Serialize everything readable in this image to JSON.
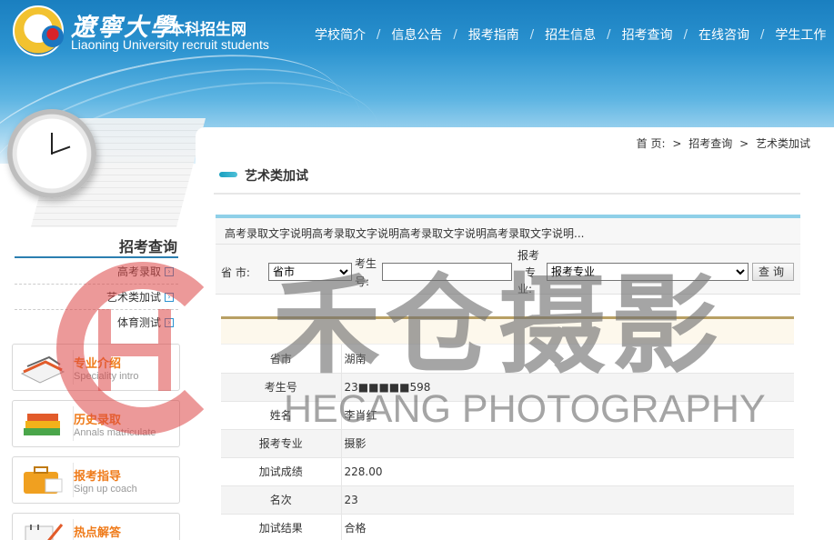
{
  "header": {
    "logo_cn": "遼寧大學",
    "logo_cn2": "本科招生网",
    "logo_en": "Liaoning University recruit students",
    "nav": [
      "学校简介",
      "信息公告",
      "报考指南",
      "招生信息",
      "招考查询",
      "在线咨询",
      "学生工作"
    ],
    "nav_sep": "/"
  },
  "sidebar": {
    "title": "招考查询",
    "links": [
      "高考录取",
      "艺术类加试",
      "体育测试"
    ],
    "cards": [
      {
        "cn": "专业介绍",
        "en": "Speciality intro",
        "icon": "books-icon"
      },
      {
        "cn": "历史录取",
        "en": "Annals matriculate",
        "icon": "stacked-books-icon"
      },
      {
        "cn": "报考指导",
        "en": "Sign up coach",
        "icon": "briefcase-icon"
      },
      {
        "cn": "热点解答",
        "icon": "notebook-pen-icon"
      }
    ]
  },
  "breadcrumb": {
    "home": "首 页:",
    "sep": ">",
    "level1": "招考查询",
    "level2": "艺术类加试"
  },
  "panel": {
    "title": "艺术类加试",
    "note": "高考录取文字说明高考录取文字说明高考录取文字说明高考录取文字说明..."
  },
  "form": {
    "province_label": "省 市:",
    "province_value": "省市",
    "exam_no_label_1": "考生",
    "exam_no_label_2": "号:",
    "exam_no_value": "",
    "major_label_1": "报考",
    "major_label_2": "专",
    "major_label_3": "业:",
    "major_value": "报考专业",
    "query_button": "查询"
  },
  "result": {
    "rows": [
      {
        "key": "省市",
        "value": "湖南"
      },
      {
        "key": "考生号",
        "value": "23■■■■■598"
      },
      {
        "key": "姓名",
        "value": "李肖红"
      },
      {
        "key": "报考专业",
        "value": "摄影"
      },
      {
        "key": "加试成绩",
        "value": "228.00"
      },
      {
        "key": "名次",
        "value": "23"
      },
      {
        "key": "加试结果",
        "value": "合格"
      }
    ]
  },
  "watermark": {
    "cn": "禾仓摄影",
    "en": "HECANG PHOTOGRAPHY",
    "color": "#dc4646"
  },
  "colors": {
    "header_blue": "#1a7fc0",
    "accent_orange": "#ef7b1a",
    "accent_teal": "#1aa0c0"
  }
}
